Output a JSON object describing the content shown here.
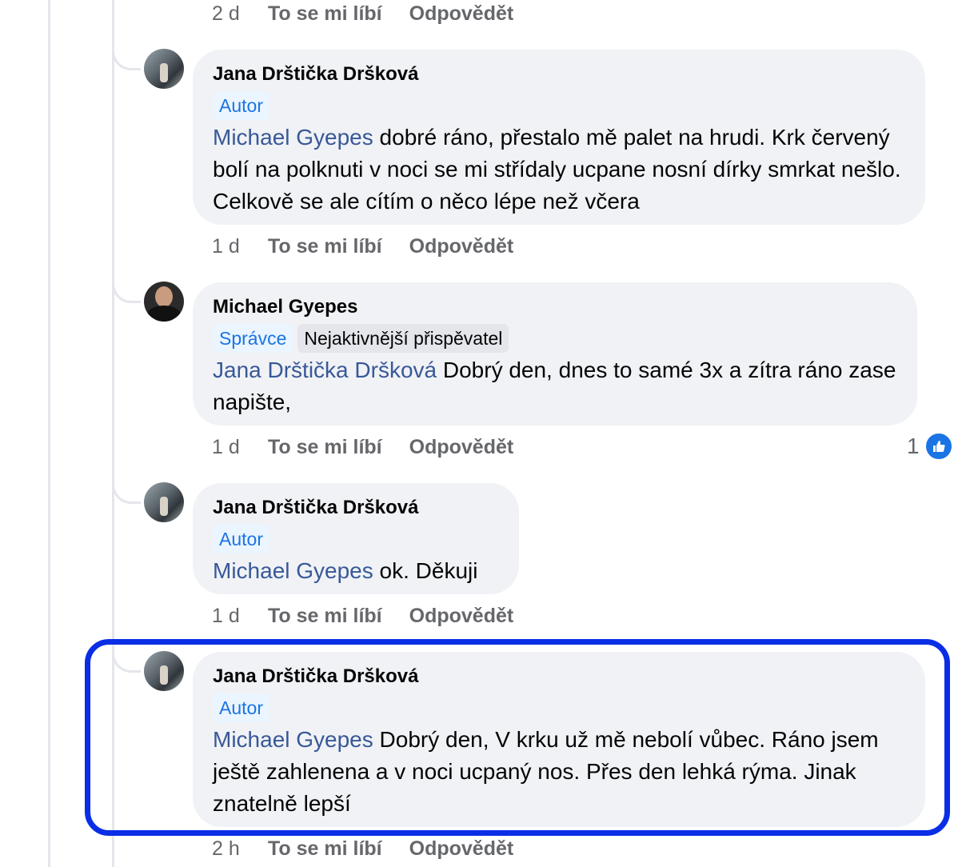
{
  "comments": [
    {
      "actions": {
        "time": "2 d",
        "like": "To se mi líbí",
        "reply": "Odpovědět"
      }
    },
    {
      "author": "Jana Drštička Dršková",
      "badges": [
        "Autor"
      ],
      "mention": "Michael Gyepes",
      "text": " dobré ráno, přestalo mě palet na hrudi. Krk červený bolí na polknuti v noci se mi střídaly ucpane nosní dírky smrkat nešlo. Celkově se ale cítím o něco lépe než včera",
      "actions": {
        "time": "1 d",
        "like": "To se mi líbí",
        "reply": "Odpovědět"
      }
    },
    {
      "author": "Michael Gyepes",
      "badges": [
        "Správce",
        "Nejaktivnější přispěvatel"
      ],
      "mention": "Jana Drštička Dršková",
      "text": " Dobrý den, dnes to samé 3x a zítra ráno zase napište,",
      "actions": {
        "time": "1 d",
        "like": "To se mi líbí",
        "reply": "Odpovědět"
      },
      "reaction_count": "1"
    },
    {
      "author": "Jana Drštička Dršková",
      "badges": [
        "Autor"
      ],
      "mention": "Michael Gyepes",
      "text": " ok. Děkuji",
      "actions": {
        "time": "1 d",
        "like": "To se mi líbí",
        "reply": "Odpovědět"
      }
    },
    {
      "author": "Jana Drštička Dršková",
      "badges": [
        "Autor"
      ],
      "mention": "Michael Gyepes",
      "text": " Dobrý den, V krku už mě nebolí vůbec. Ráno jsem ještě zahlenena a v noci ucpaný nos. Přes den lehká rýma. Jinak znatelně lepší",
      "actions": {
        "time": "2 h",
        "like": "To se mi líbí",
        "reply": "Odpovědět"
      },
      "highlighted": true
    }
  ],
  "colors": {
    "mention": "#385898",
    "role_badge": "#1b74e4",
    "bubble_bg": "#f0f2f5",
    "highlight_border": "#0a2ee6",
    "like_icon": "#1b74e4"
  }
}
